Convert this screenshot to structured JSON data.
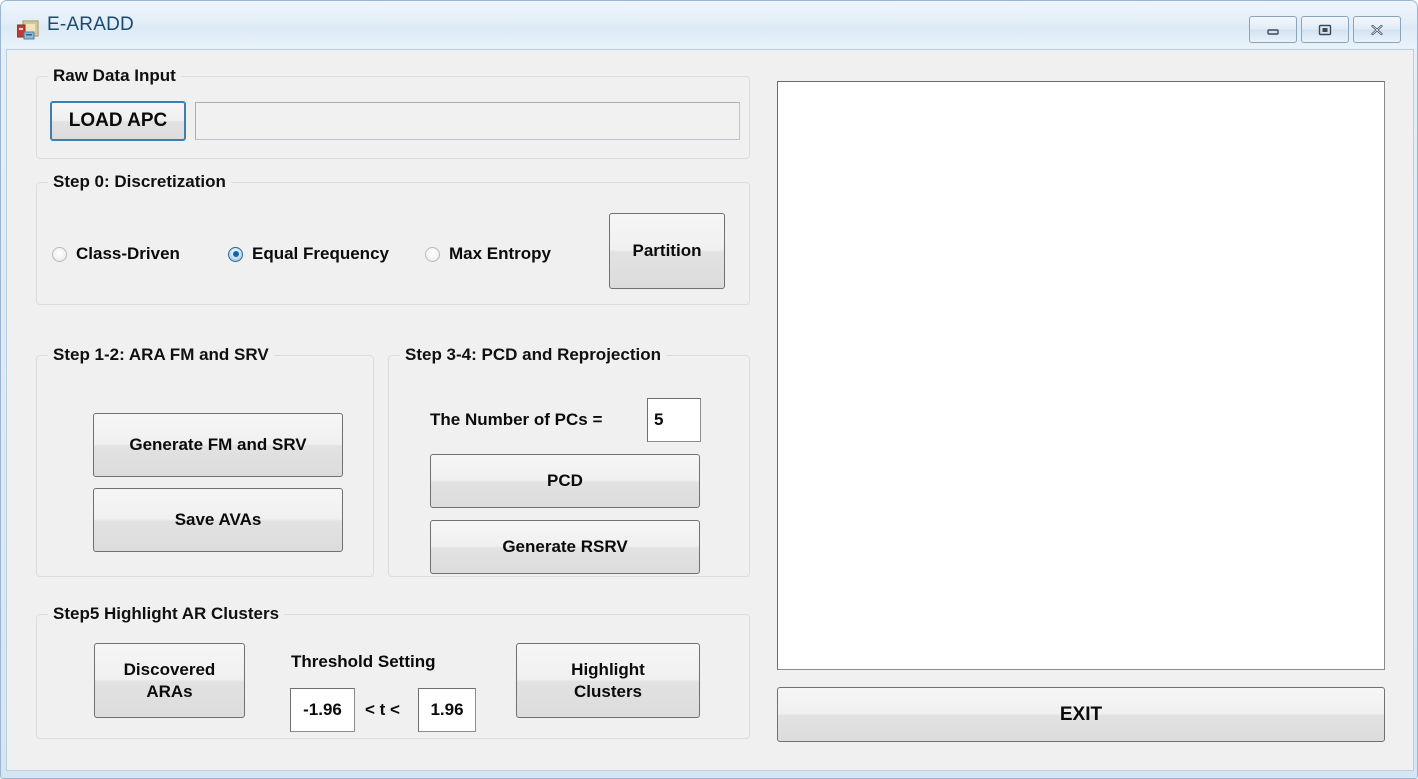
{
  "window": {
    "title": "E-ARADD",
    "icon": "form-designer-icon",
    "frame_color": "#d6e5f3",
    "controls": [
      {
        "name": "minimize",
        "glyph": "minimize-icon"
      },
      {
        "name": "maximize",
        "glyph": "maximize-icon"
      },
      {
        "name": "close",
        "glyph": "close-icon"
      }
    ]
  },
  "raw_data_input": {
    "legend": "Raw Data Input",
    "load_button": "LOAD APC",
    "path_value": "",
    "path_placeholder": ""
  },
  "step0": {
    "legend": "Step 0: Discretization",
    "options": [
      {
        "label": "Class-Driven",
        "checked": false
      },
      {
        "label": "Equal Frequency",
        "checked": true
      },
      {
        "label": "Max Entropy",
        "checked": false
      }
    ],
    "partition_button": "Partition"
  },
  "step12": {
    "legend": "Step 1-2: ARA FM and SRV",
    "generate_button": "Generate FM and SRV",
    "save_button": "Save AVAs"
  },
  "step34": {
    "legend": "Step 3-4: PCD and Reprojection",
    "pcs_label": "The Number of PCs =",
    "pcs_value": "5",
    "pcd_button": "PCD",
    "rsrv_button": "Generate RSRV"
  },
  "step5": {
    "legend": "Step5 Highlight AR Clusters",
    "discovered_button_line1": "Discovered",
    "discovered_button_line2": "ARAs",
    "threshold_label": "Threshold Setting",
    "threshold_low": "-1.96",
    "threshold_operator": "< t <",
    "threshold_high": "1.96",
    "highlight_button_line1": "Highlight",
    "highlight_button_line2": "Clusters"
  },
  "output": {
    "text": "",
    "exit_button": "EXIT"
  },
  "colors": {
    "accent": "#3c7fb1",
    "radio_selected": "#1763a5",
    "title_text": "#1c4a6e",
    "button_face": "#e8e8e8"
  }
}
